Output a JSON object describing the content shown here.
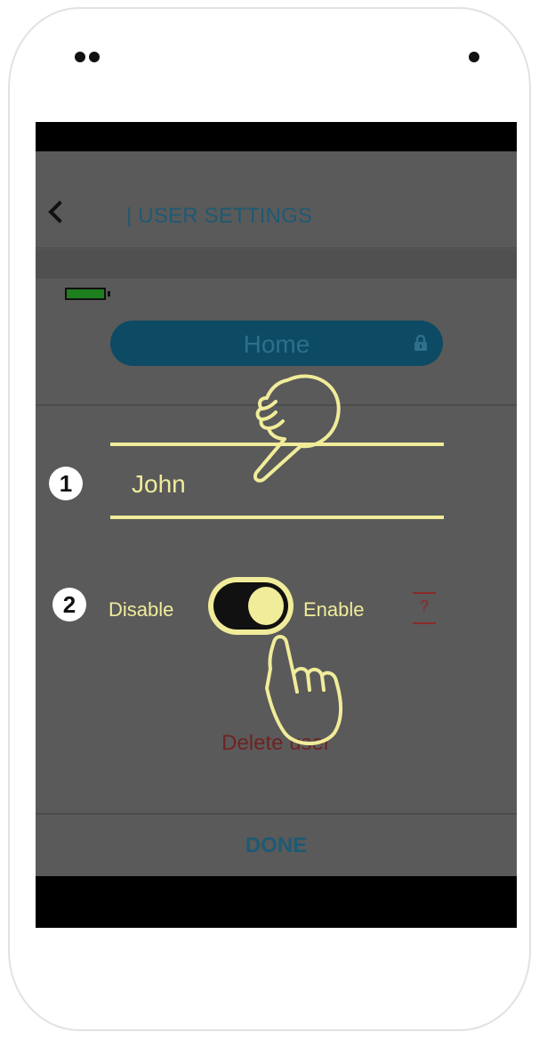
{
  "header": {
    "back_icon": "chevron-left-icon",
    "title": "| USER SETTINGS"
  },
  "status": {
    "battery_icon": "battery-icon",
    "battery_color": "#1e7f1e"
  },
  "location_pill": {
    "label": "Home",
    "lock_icon": "lock-icon"
  },
  "form": {
    "step1_number": "1",
    "name_value": "John",
    "step2_number": "2",
    "disable_label": "Disable",
    "enable_label": "Enable",
    "toggle_state": "enabled",
    "help_label": "?",
    "delete_label": "Delete user"
  },
  "footer": {
    "done_label": "DONE"
  },
  "colors": {
    "highlight": "#f0ec9a",
    "accent": "#1e5a73",
    "danger": "#6e2323"
  },
  "gestures": [
    {
      "icon": "pointing-hand-icon",
      "target": "name-field"
    },
    {
      "icon": "tapping-hand-icon",
      "target": "enable-toggle"
    }
  ]
}
